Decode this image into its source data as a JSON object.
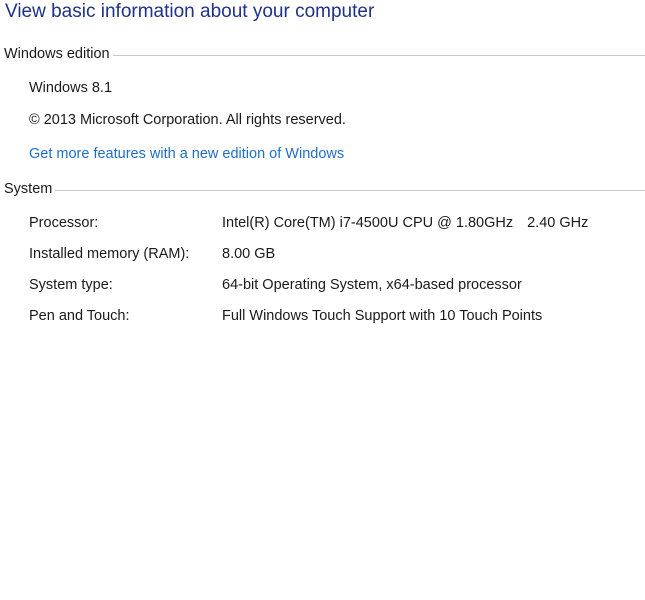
{
  "page": {
    "title": "View basic information about your computer"
  },
  "windows_edition": {
    "section_title": "Windows edition",
    "edition": "Windows 8.1",
    "copyright": "© 2013 Microsoft Corporation. All rights reserved.",
    "upgrade_link": "Get more features with a new edition of Windows"
  },
  "system": {
    "section_title": "System",
    "rows": [
      {
        "label": "Processor:",
        "value": "Intel(R) Core(TM) i7-4500U CPU @ 1.80GHz",
        "extra": "2.40 GHz"
      },
      {
        "label": "Installed memory (RAM):",
        "value": "8.00 GB"
      },
      {
        "label": "System type:",
        "value": "64-bit Operating System, x64-based processor"
      },
      {
        "label": "Pen and Touch:",
        "value": "Full Windows Touch Support with 10 Touch Points"
      }
    ]
  },
  "colors": {
    "title": "#1e3287",
    "link": "#1e6ec8",
    "rule": "#c8c8c8"
  }
}
